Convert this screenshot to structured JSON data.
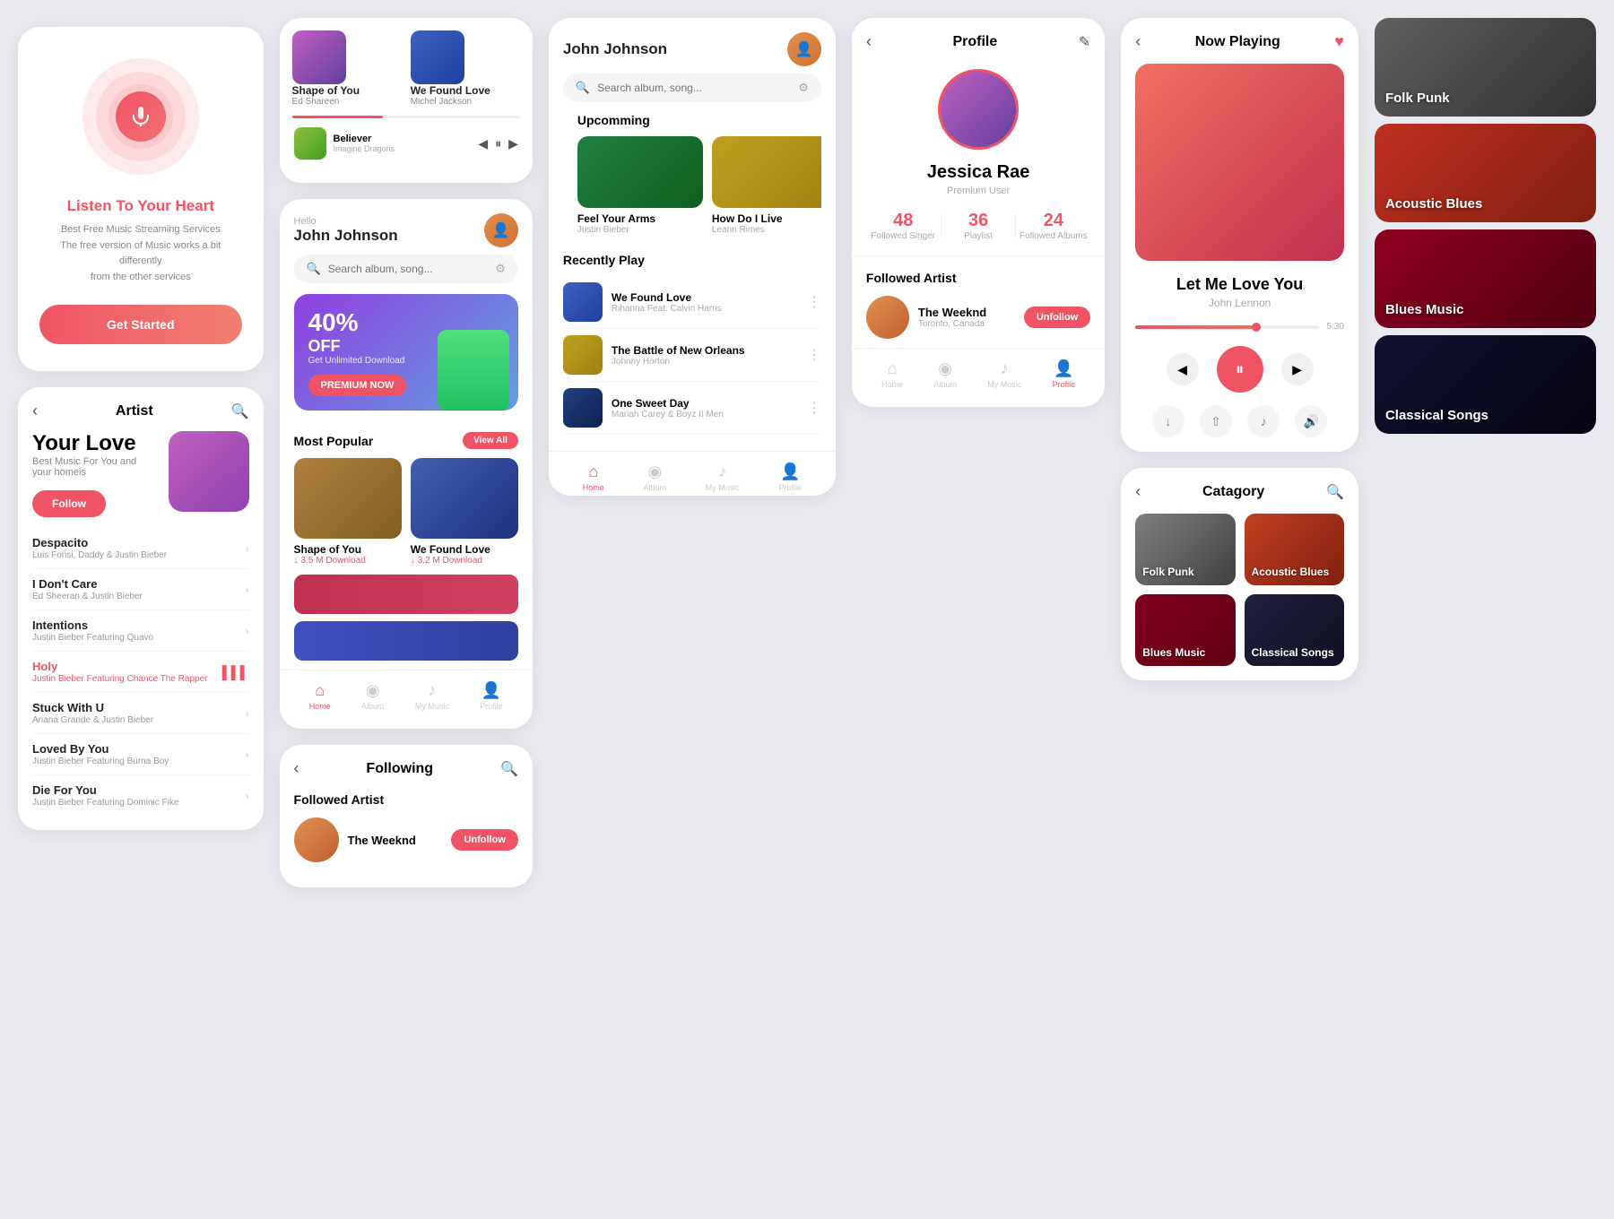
{
  "listen_screen": {
    "title_plain": "Listen To Your",
    "title_accent": "Heart",
    "subtitle_line1": "Best Free Music Streaming Services",
    "subtitle_line2": "The free version of Music works a bit differently",
    "subtitle_line3": "from the other services",
    "cta_label": "Get Started"
  },
  "artist_screen": {
    "back_icon": "‹",
    "title": "Artist",
    "hero_title": "Your Love",
    "hero_sub": "Best Music For You and your homeis",
    "follow_label": "Follow",
    "songs": [
      {
        "name": "Despacito",
        "artist": "Luis Fonsi, Daddy & Justin Bieber",
        "active": false
      },
      {
        "name": "I Don't Care",
        "artist": "Ed Sheeran & Justin Bieber",
        "active": false
      },
      {
        "name": "Intentions",
        "artist": "Justin Bieber Featuring Quavo",
        "active": false
      },
      {
        "name": "Holy",
        "artist": "Justin Bieber Featuring Chance The Rapper",
        "active": true
      },
      {
        "name": "Stuck With U",
        "artist": "Ariana Grande & Justin Bieber",
        "active": false
      },
      {
        "name": "Loved By You",
        "artist": "Justin Bieber Featuring Burna Boy",
        "active": false
      },
      {
        "name": "Die For You",
        "artist": "Justin Bieber Featuring Dominic Fike",
        "active": false
      }
    ]
  },
  "top_songs": [
    {
      "title": "Shape of You",
      "artist": "Ed Shareen"
    },
    {
      "title": "We Found Love",
      "artist": "Michel Jackson"
    }
  ],
  "mini_player": {
    "title": "Believer",
    "artist": "Imagine Dragons"
  },
  "home_screen": {
    "hello": "Hello",
    "user_name": "John Johnson",
    "search_placeholder": "Search album, song...",
    "promo": {
      "percent": "40%",
      "off": "OFF",
      "subtitle": "Get Unlimited Download",
      "cta": "PREMIUM NOW"
    },
    "most_popular_title": "Most Popular",
    "view_all": "View All",
    "popular_songs": [
      {
        "title": "Shape of You",
        "download": "3.5 M Download"
      },
      {
        "title": "We Found Love",
        "download": "3.2 M Download"
      }
    ],
    "nav": {
      "home": "Home",
      "album": "Album",
      "my_music": "My Music",
      "profile": "Profile"
    }
  },
  "following_screen": {
    "title": "Following",
    "section_title": "Followed Artist",
    "artist": {
      "name": "The Weeknd",
      "city": "",
      "unfollow_label": "Unfollow"
    }
  },
  "main_home": {
    "user_name": "John Johnson",
    "search_placeholder": "Search album, song...",
    "upcoming_title": "Upcomming",
    "upcoming": [
      {
        "title": "Feel Your Arms",
        "artist": "Justin Bieber"
      },
      {
        "title": "How Do I Live",
        "artist": "Leann Rimes"
      }
    ],
    "recently_title": "Recently Play",
    "recent_songs": [
      {
        "title": "We Found Love",
        "artist": "Rihanna Feat. Calvin Harris"
      },
      {
        "title": "The Battle of New Orleans",
        "artist": "Johnny Horton"
      },
      {
        "title": "One Sweet Day",
        "artist": "Mariah Carey & Boyz II Men"
      }
    ],
    "nav": {
      "home": "Home",
      "album": "Album",
      "my_music": "My Music",
      "profile": "Profile"
    }
  },
  "profile_screen": {
    "back_icon": "‹",
    "title": "Profile",
    "edit_icon": "✎",
    "name": "Jessica Rae",
    "user_type": "Premium User",
    "stats": [
      {
        "num": "48",
        "label": "Followed Singer"
      },
      {
        "num": "36",
        "label": "Playlist"
      },
      {
        "num": "24",
        "label": "Followed Albums"
      }
    ],
    "followed_title": "Followed Artist",
    "followed_artist": {
      "name": "The Weeknd",
      "city": "Toronto, Canada",
      "unfollow_label": "Unfollow"
    },
    "nav": {
      "home": "Home",
      "album": "Album",
      "my_music": "My Music",
      "profile": "Profile"
    }
  },
  "now_playing": {
    "back_icon": "‹",
    "title": "Now Playing",
    "song_title": "Let Me Love You",
    "song_artist": "John Lennon",
    "time_current": "",
    "time_total": "5:30",
    "controls": {
      "prev": "◀",
      "play": "⏸",
      "next": "▶"
    },
    "actions": [
      "↓",
      "⇧",
      "♪",
      "🔊"
    ]
  },
  "category_screen": {
    "back_icon": "‹",
    "title": "Catagory",
    "search_icon": "🔍",
    "categories": [
      {
        "label": "Folk Punk",
        "bg": "cat-bg1"
      },
      {
        "label": "Acoustic Blues",
        "bg": "cat-bg2"
      },
      {
        "label": "Blues Music",
        "bg": "cat-bg3"
      },
      {
        "label": "Classical Songs",
        "bg": "cat-bg4"
      }
    ]
  },
  "category_big": [
    {
      "label": "Folk Punk",
      "bg": "cat-big-bg1"
    },
    {
      "label": "Acoustic Blues",
      "bg": "cat-big-bg2"
    },
    {
      "label": "Blues Music",
      "bg": "cat-big-bg3"
    },
    {
      "label": "Classical Songs",
      "bg": "cat-big-bg4"
    }
  ]
}
